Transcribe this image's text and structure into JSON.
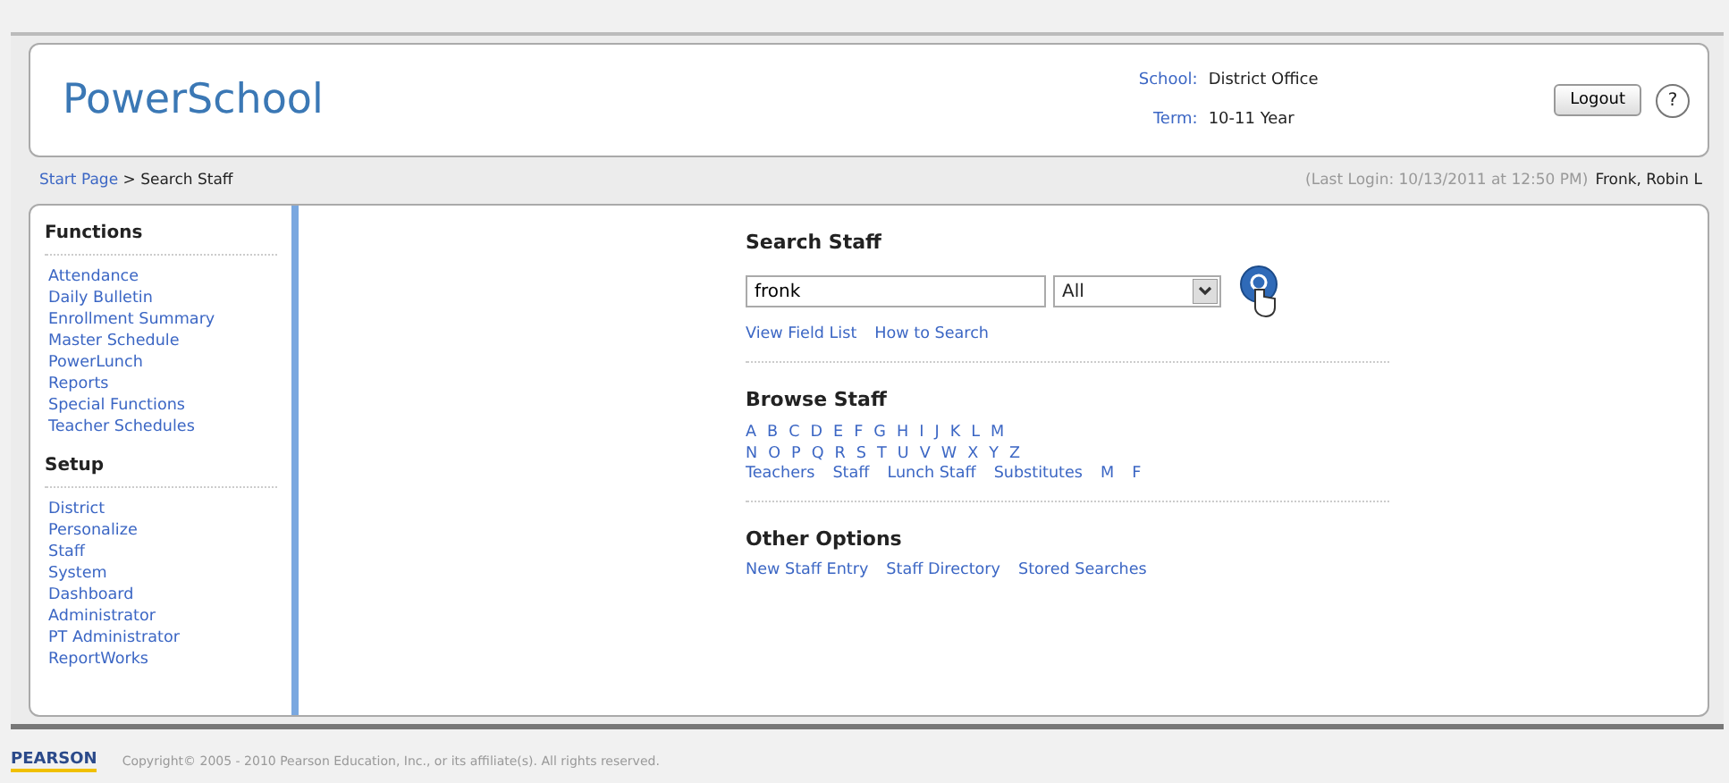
{
  "header": {
    "logo": "PowerSchool",
    "school_label": "School:",
    "school": "District Office",
    "term_label": "Term:",
    "term": "10-11 Year",
    "logout": "Logout",
    "help": "?"
  },
  "breadcrumb": {
    "link": "Start Page",
    "separator": ">",
    "current": "Search Staff",
    "last_login": "(Last Login: 10/13/2011 at 12:50 PM)",
    "user": "Fronk, Robin L"
  },
  "sidebar": [
    {
      "heading": "Functions",
      "items": [
        "Attendance",
        "Daily Bulletin",
        "Enrollment Summary",
        "Master Schedule",
        "PowerLunch",
        "Reports",
        "Special Functions",
        "Teacher Schedules"
      ]
    },
    {
      "heading": "Setup",
      "items": [
        "District",
        "Personalize",
        "Staff",
        "System",
        "Dashboard",
        "Administrator",
        "PT Administrator",
        "ReportWorks"
      ]
    }
  ],
  "search": {
    "heading": "Search Staff",
    "value": "fronk",
    "filter": "All",
    "links": [
      "View Field List",
      "How to Search"
    ]
  },
  "browse": {
    "heading": "Browse Staff",
    "letters_1": [
      "A",
      "B",
      "C",
      "D",
      "E",
      "F",
      "G",
      "H",
      "I",
      "J",
      "K",
      "L",
      "M"
    ],
    "letters_2": [
      "N",
      "O",
      "P",
      "Q",
      "R",
      "S",
      "T",
      "U",
      "V",
      "W",
      "X",
      "Y",
      "Z"
    ],
    "links": [
      "Teachers",
      "Staff",
      "Lunch Staff",
      "Substitutes",
      "M",
      "F"
    ]
  },
  "other": {
    "heading": "Other Options",
    "links": [
      "New Staff Entry",
      "Staff Directory",
      "Stored Searches"
    ]
  },
  "footer": {
    "brand": "PEARSON",
    "copyright": "Copyright© 2005 - 2010 Pearson Education, Inc., or its affiliate(s). All rights reserved."
  }
}
